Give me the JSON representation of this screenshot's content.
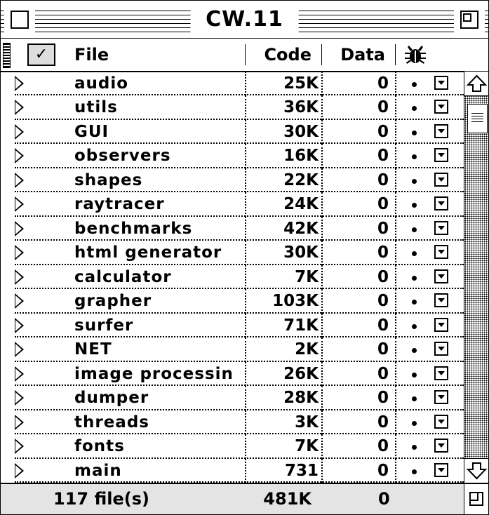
{
  "window": {
    "title": "CW.11"
  },
  "columns": {
    "file": "File",
    "code": "Code",
    "data": "Data"
  },
  "rows": [
    {
      "name": "audio",
      "code": "25K",
      "data": "0"
    },
    {
      "name": "utils",
      "code": "36K",
      "data": "0"
    },
    {
      "name": "GUI",
      "code": "30K",
      "data": "0"
    },
    {
      "name": "observers",
      "code": "16K",
      "data": "0"
    },
    {
      "name": "shapes",
      "code": "22K",
      "data": "0"
    },
    {
      "name": "raytracer",
      "code": "24K",
      "data": "0"
    },
    {
      "name": "benchmarks",
      "code": "42K",
      "data": "0"
    },
    {
      "name": "html generator",
      "code": "30K",
      "data": "0"
    },
    {
      "name": "calculator",
      "code": "7K",
      "data": "0"
    },
    {
      "name": "grapher",
      "code": "103K",
      "data": "0"
    },
    {
      "name": "surfer",
      "code": "71K",
      "data": "0"
    },
    {
      "name": "NET",
      "code": "2K",
      "data": "0"
    },
    {
      "name": "image processin",
      "code": "26K",
      "data": "0"
    },
    {
      "name": "dumper",
      "code": "28K",
      "data": "0"
    },
    {
      "name": "threads",
      "code": "3K",
      "data": "0"
    },
    {
      "name": "fonts",
      "code": "7K",
      "data": "0"
    },
    {
      "name": "main",
      "code": "731",
      "data": "0"
    }
  ],
  "footer": {
    "files": "117 file(s)",
    "code_total": "481K",
    "data_total": "0"
  },
  "icons": {
    "expand": "disclosure-triangle-icon",
    "popup": "popup-menu-icon",
    "debug": "bug-icon",
    "check": "checkmark-icon"
  }
}
